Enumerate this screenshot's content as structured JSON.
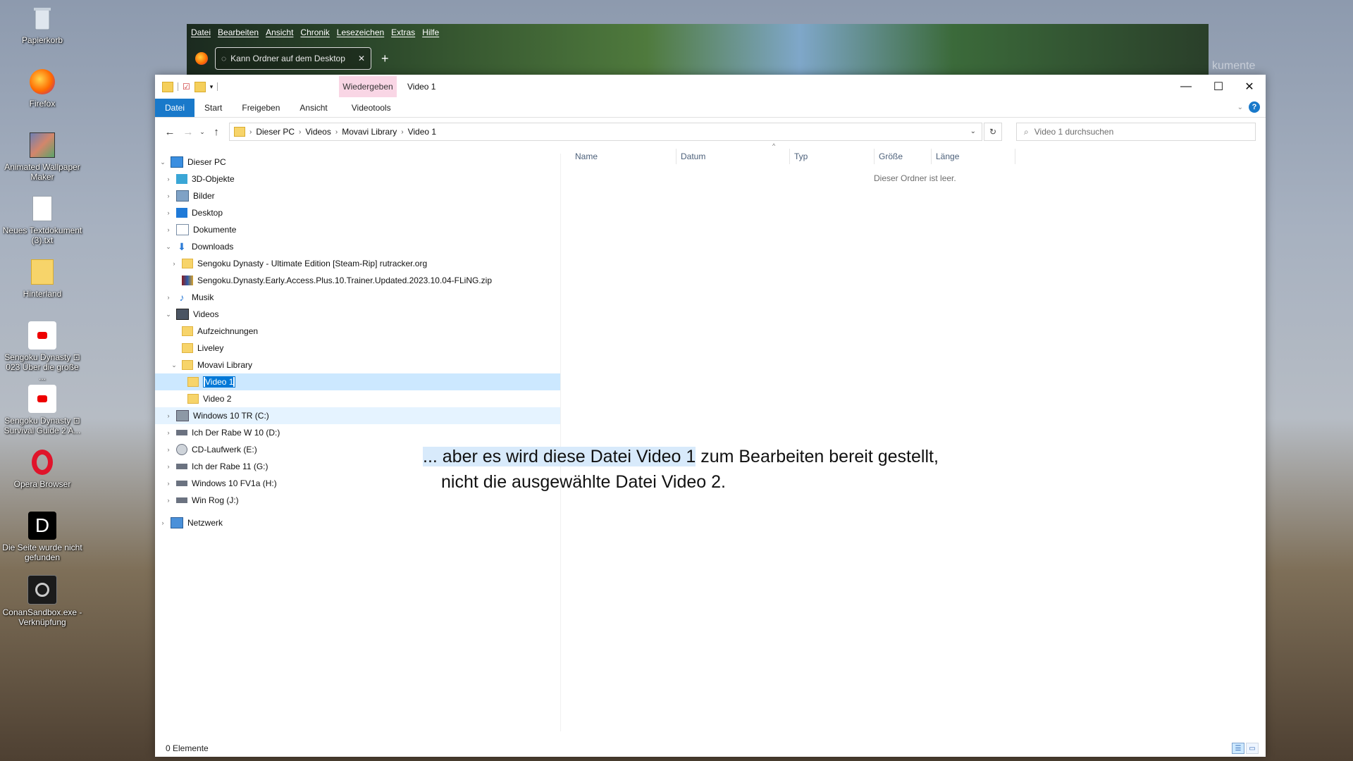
{
  "desktop": {
    "icons": [
      {
        "label": "Papierkorb",
        "icon": "recycle-bin-icon"
      },
      {
        "label": "Firefox",
        "icon": "firefox-icon"
      },
      {
        "label": "Animated Wallpaper Maker",
        "icon": "wallpaper-maker-icon"
      },
      {
        "label": "Neues Textdokument (3).txt",
        "icon": "text-document-icon"
      },
      {
        "label": "Hinterland",
        "icon": "folder-icon"
      },
      {
        "label": "Sengoku Dynasty ⊡ 023 Über die große ...",
        "icon": "youtube-shortcut-icon"
      },
      {
        "label": "Sengoku Dynasty ⊡ Survival Guide 2 A...",
        "icon": "youtube-shortcut-icon"
      },
      {
        "label": "Opera Browser",
        "icon": "opera-icon"
      },
      {
        "label": "Die Seite wurde nicht gefunden",
        "icon": "d-logo-icon"
      },
      {
        "label": "ConanSandbox.exe - Verknüpfung",
        "icon": "conan-shortcut-icon"
      }
    ]
  },
  "firefox": {
    "menu": [
      "Datei",
      "Bearbeiten",
      "Ansicht",
      "Chronik",
      "Lesezeichen",
      "Extras",
      "Hilfe"
    ],
    "tab_title": "Kann Ordner auf dem Desktop",
    "ghost_text": "kumente"
  },
  "explorer": {
    "context_tab": "Wiedergeben",
    "title": "Video 1",
    "ribbon_tabs": [
      "Datei",
      "Start",
      "Freigeben",
      "Ansicht",
      "Videotools"
    ],
    "breadcrumb": [
      "Dieser PC",
      "Videos",
      "Movavi Library",
      "Video 1"
    ],
    "search_placeholder": "Video 1 durchsuchen",
    "columns": [
      "Name",
      "Datum",
      "Typ",
      "Größe",
      "Länge"
    ],
    "empty_message": "Dieser Ordner ist leer.",
    "status": "0 Elemente",
    "tree": {
      "this_pc": "Dieser PC",
      "objects3d": "3D-Objekte",
      "pictures": "Bilder",
      "desktop": "Desktop",
      "documents": "Dokumente",
      "downloads": "Downloads",
      "dl_folder": "Sengoku Dynasty - Ultimate Edition [Steam-Rip] rutracker.org",
      "dl_zip": "Sengoku.Dynasty.Early.Access.Plus.10.Trainer.Updated.2023.10.04-FLiNG.zip",
      "music": "Musik",
      "videos": "Videos",
      "recordings": "Aufzeichnungen",
      "liveley": "Liveley",
      "movavi": "Movavi Library",
      "video1": "Video 1",
      "video2": "Video 2",
      "drive_c": "Windows 10 TR (C:)",
      "drive_d": "Ich Der Rabe W 10 (D:)",
      "drive_e": "CD-Laufwerk (E:)",
      "drive_g": "Ich der Rabe 11 (G:)",
      "drive_h": "Windows 10 FV1a (H:)",
      "drive_j": "Win Rog (J:)",
      "network": "Netzwerk"
    }
  },
  "caption": {
    "line1_highlight": "... aber es wird diese Datei Video 1",
    "line1_rest": " zum Bearbeiten bereit gestellt,",
    "line2": "nicht die ausgewählte Datei Video 2."
  }
}
